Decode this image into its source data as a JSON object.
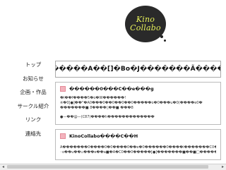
{
  "logo": {
    "line1": "Kino",
    "line2": "Collabo"
  },
  "nav": {
    "items": [
      "トップ",
      "お知らせ",
      "企画・作品",
      "サークル紹介",
      "リンク",
      "連絡先"
    ]
  },
  "main": {
    "headline": "�����A��[]�Bo�J�������Ã����",
    "cards": [
      {
        "title": "������0���C��e���g",
        "lines": [
          "�i��f����5�o�W������!",
          "※�0[●]��\"�A0���0��0��0��0�����o�0���u�0(����e0�",
          "�������■ 8����▯��■ ���8",
          "●—��@—(C87)����h�������������"
        ]
      },
      {
        "title": "KinoCollabo����C��H",
        "lines": [
          "A�������0����0�0����0��e�0������0����i�������C0��X�����",
          "◦o��u��▫���e��a■�A�C0��0�����[●]�������■��■□�����■ �"
        ]
      }
    ]
  },
  "scrollbar": {
    "left_arrow": "◂",
    "right_arrow": "▸"
  }
}
